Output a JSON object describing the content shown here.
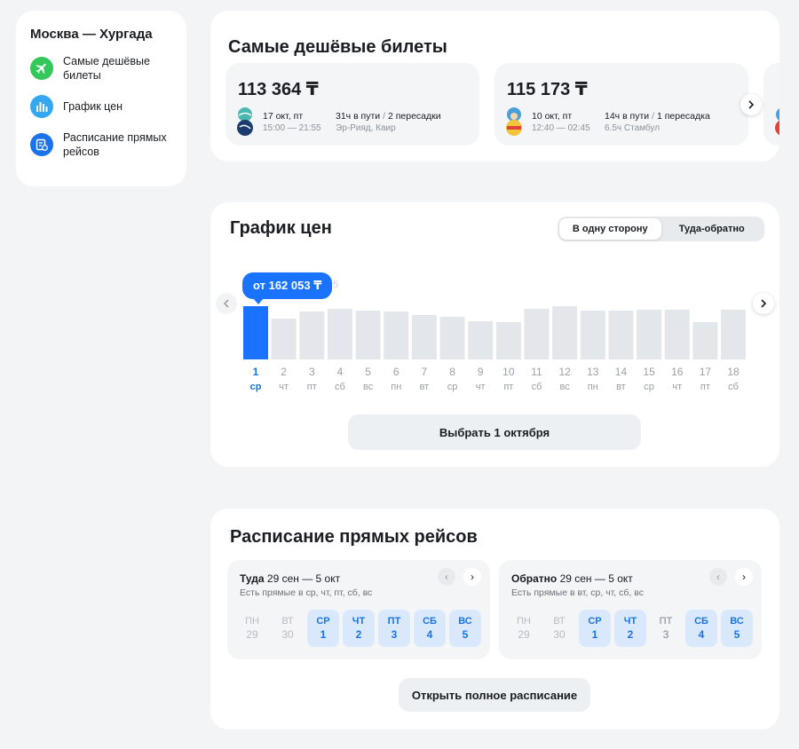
{
  "sidebar": {
    "title": "Москва — Хургада",
    "items": [
      {
        "label": "Самые дешёвые билеты",
        "icon": "plane-icon",
        "color": "#34c759"
      },
      {
        "label": "График цен",
        "icon": "bar-chart-icon",
        "color": "#35a7f0"
      },
      {
        "label": "Расписание прямых рейсов",
        "icon": "schedule-icon",
        "color": "#1a73e8"
      }
    ]
  },
  "cheapest": {
    "title": "Самые дешёвые билеты",
    "tickets": [
      {
        "price": "113 364 ₸",
        "date": "17 окт, пт",
        "times": "15:00 — 21:55",
        "duration": "31ч в пути",
        "stops": "2 пересадки",
        "via": "Эр-Рияд, Каир"
      },
      {
        "price": "115 173 ₸",
        "date": "10 окт, пт",
        "times": "12:40 — 02:45",
        "duration": "14ч в пути",
        "stops": "1 пересадка",
        "via": "6.5ч Стамбул"
      }
    ]
  },
  "price_chart": {
    "title": "График цен",
    "toggle": {
      "one_way": "В одну сторону",
      "round_trip": "Туда-обратно"
    },
    "tooltip": "от 162 053 ₸",
    "ghost_label": "5",
    "select_button": "Выбрать 1 октября",
    "accent": "#1a73ff"
  },
  "chart_data": {
    "type": "bar",
    "title": "",
    "xlabel": "",
    "ylabel": "",
    "categories": [
      "1",
      "2",
      "3",
      "4",
      "5",
      "6",
      "7",
      "8",
      "9",
      "10",
      "11",
      "12",
      "13",
      "14",
      "15",
      "16",
      "17",
      "18"
    ],
    "weekdays": [
      "ср",
      "чт",
      "пт",
      "сб",
      "вс",
      "пн",
      "вт",
      "ср",
      "чт",
      "пт",
      "сб",
      "вс",
      "пн",
      "вт",
      "ср",
      "чт",
      "пт",
      "сб"
    ],
    "values": [
      60,
      46,
      54,
      57,
      55,
      54,
      50,
      48,
      43,
      42,
      57,
      60,
      55,
      55,
      56,
      56,
      42,
      56
    ],
    "selected_index": 0,
    "ylim": [
      0,
      64
    ]
  },
  "schedule": {
    "title": "Расписание прямых рейсов",
    "outbound": {
      "label": "Туда",
      "range": "29 сен — 5 окт",
      "note": "Есть прямые в ср, чт, пт, сб, вс",
      "days": [
        {
          "wd": "ПН",
          "n": "29",
          "state": "off"
        },
        {
          "wd": "ВТ",
          "n": "30",
          "state": "off"
        },
        {
          "wd": "СР",
          "n": "1",
          "state": "av"
        },
        {
          "wd": "ЧТ",
          "n": "2",
          "state": "av"
        },
        {
          "wd": "ПТ",
          "n": "3",
          "state": "av"
        },
        {
          "wd": "СБ",
          "n": "4",
          "state": "av"
        },
        {
          "wd": "ВС",
          "n": "5",
          "state": "av"
        }
      ]
    },
    "return": {
      "label": "Обратно",
      "range": "29 сен — 5 окт",
      "note": "Есть прямые в вт, ср, чт, сб, вс",
      "days": [
        {
          "wd": "ПН",
          "n": "29",
          "state": "off"
        },
        {
          "wd": "ВТ",
          "n": "30",
          "state": "off"
        },
        {
          "wd": "СР",
          "n": "1",
          "state": "av"
        },
        {
          "wd": "ЧТ",
          "n": "2",
          "state": "av"
        },
        {
          "wd": "ПТ",
          "n": "3",
          "state": "mid"
        },
        {
          "wd": "СБ",
          "n": "4",
          "state": "av"
        },
        {
          "wd": "ВС",
          "n": "5",
          "state": "av"
        }
      ]
    },
    "open_button": "Открыть полное расписание"
  }
}
